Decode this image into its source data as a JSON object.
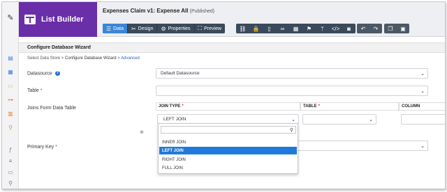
{
  "app": {
    "name": "List Builder"
  },
  "document": {
    "title": "Expenses Claim v1: Expense All",
    "status": "(Published)"
  },
  "tabs": [
    {
      "label": "Data",
      "icon": "☰",
      "active": true
    },
    {
      "label": "Design",
      "icon": "✂",
      "active": false
    },
    {
      "label": "Properties",
      "icon": "⚙",
      "active": false
    },
    {
      "label": "Preview",
      "icon": "⛶",
      "active": false
    }
  ],
  "tools": [
    {
      "name": "hierarchy-icon",
      "glyph": "⛓"
    },
    {
      "name": "lock-icon",
      "glyph": "🔒"
    },
    {
      "name": "mobile-icon",
      "glyph": "▯"
    },
    {
      "name": "glasses-icon",
      "glyph": "∞"
    },
    {
      "name": "building-icon",
      "glyph": "▦"
    },
    {
      "name": "flag-icon",
      "glyph": "⚑"
    },
    {
      "name": "branch-icon",
      "glyph": "ᛘ"
    },
    {
      "name": "code-icon",
      "glyph": "</>"
    },
    {
      "name": "camera-icon",
      "glyph": "◙"
    }
  ],
  "panel": {
    "title": "Configure Database Wizard",
    "breadcrumbs": [
      "Select Data Store",
      "Configure Database Wizard",
      "Advanced"
    ],
    "separator": ">"
  },
  "fields": {
    "datasource": {
      "label": "Datasource",
      "value": "Default Datasource"
    },
    "table": {
      "label": "Table",
      "required_mark": "*",
      "value": ""
    },
    "joins": {
      "label": "Joins Form Data Table"
    },
    "primary_key": {
      "label": "Primary Key",
      "required_mark": "*",
      "value": ""
    }
  },
  "join_grid": {
    "headers": [
      "JOIN TYPE",
      "TABLE",
      "COLUMN"
    ],
    "required_mark": "*",
    "join_type_value": "LEFT JOIN"
  },
  "join_dropdown": {
    "search_placeholder": "",
    "options": [
      "INNER JOIN",
      "LEFT JOIN",
      "RIGHT JOIN",
      "FULL JOIN"
    ],
    "selected": "LEFT JOIN"
  },
  "colors": {
    "brand": "#6a2ea8",
    "toolbar": "#3a4a5c",
    "active_tab": "#3c86d6",
    "selected_option": "#1f7ad9",
    "required": "#d9302c"
  }
}
